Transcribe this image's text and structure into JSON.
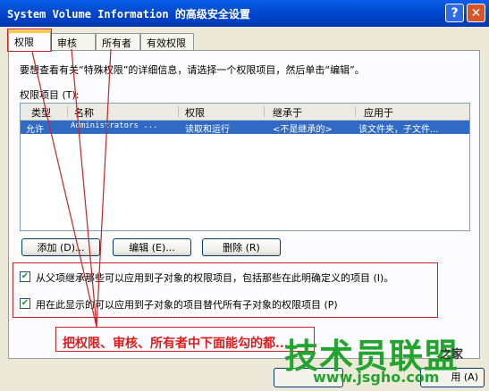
{
  "window": {
    "title": "System Volume Information 的高级安全设置",
    "help_label": "?",
    "close_label": "✕"
  },
  "tabs": [
    {
      "label": "权限"
    },
    {
      "label": "审核"
    },
    {
      "label": "所有者"
    },
    {
      "label": "有效权限"
    }
  ],
  "permissions": {
    "info_text": "要想查看有关“特殊权限”的详细信息，请选择一个权限项目，然后单击“编辑”。",
    "list_label": "权限项目 (T):",
    "columns": [
      "类型",
      "名称",
      "权限",
      "继承于",
      "应用于"
    ],
    "rows": [
      {
        "type": "允许",
        "name": "Administrators ...",
        "permission": "读取和运行",
        "inherited_from": "<不是继承的>",
        "applies_to": "该文件夹，子文件..."
      }
    ],
    "add_label": "添加 (D)...",
    "edit_label": "编辑 (E)...",
    "remove_label": "删除 (R)",
    "inherit_checkbox_label": "从父项继承那些可以应用到子对象的权限项目，包括那些在此明确定义的项目 (I)。",
    "inherit_checked": true,
    "replace_checkbox_label": "用在此显示的可以应用到子对象的项目替代所有子对象的权限项目 (P)",
    "replace_checked": true
  },
  "annotation": {
    "text": "把权限、审核、所有者中下面能勾的都..."
  },
  "watermark": {
    "logo_text": "技术员联盟",
    "suffix": "之家",
    "url": "www.jsgho.com"
  },
  "footer": {
    "apply_label": "用 (A)"
  },
  "colors": {
    "titlebar": "#0054E3",
    "selection": "#316AC5",
    "annotation_red": "#D02020",
    "watermark_green": "#22A52E"
  }
}
